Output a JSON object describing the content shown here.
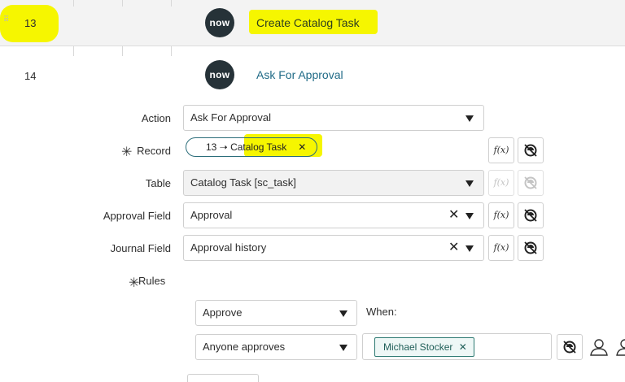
{
  "steps": [
    {
      "number": "13",
      "logo": "now",
      "title": "Create Catalog Task"
    },
    {
      "number": "14",
      "logo": "now",
      "title": "Ask For Approval"
    }
  ],
  "form": {
    "action": {
      "label": "Action",
      "value": "Ask For Approval"
    },
    "record": {
      "label": "Record",
      "pill": "13 ➝ Catalog Task",
      "pill_remove": "✕"
    },
    "table": {
      "label": "Table",
      "value": "Catalog Task [sc_task]"
    },
    "approval_field": {
      "label": "Approval Field",
      "value": "Approval"
    },
    "journal_field": {
      "label": "Journal Field",
      "value": "Approval history"
    },
    "rules": {
      "label": "Rules",
      "action_value": "Approve",
      "when_label": "When:",
      "condition_value": "Anyone approves",
      "approver_tag": "Michael Stocker",
      "approver_remove": "✕"
    },
    "function_button": "f(x)",
    "clear_icon": "✕",
    "required_mark": "✳"
  },
  "icons": {
    "drag": "drag-handle-icon",
    "dropdown": "chevron-down-icon",
    "function": "function-icon",
    "datapill": "datapill-picker-icon",
    "user": "user-icon"
  },
  "colors": {
    "highlight": "#f6f600",
    "title_link": "#1f6a86",
    "logo_bg": "#263238"
  }
}
